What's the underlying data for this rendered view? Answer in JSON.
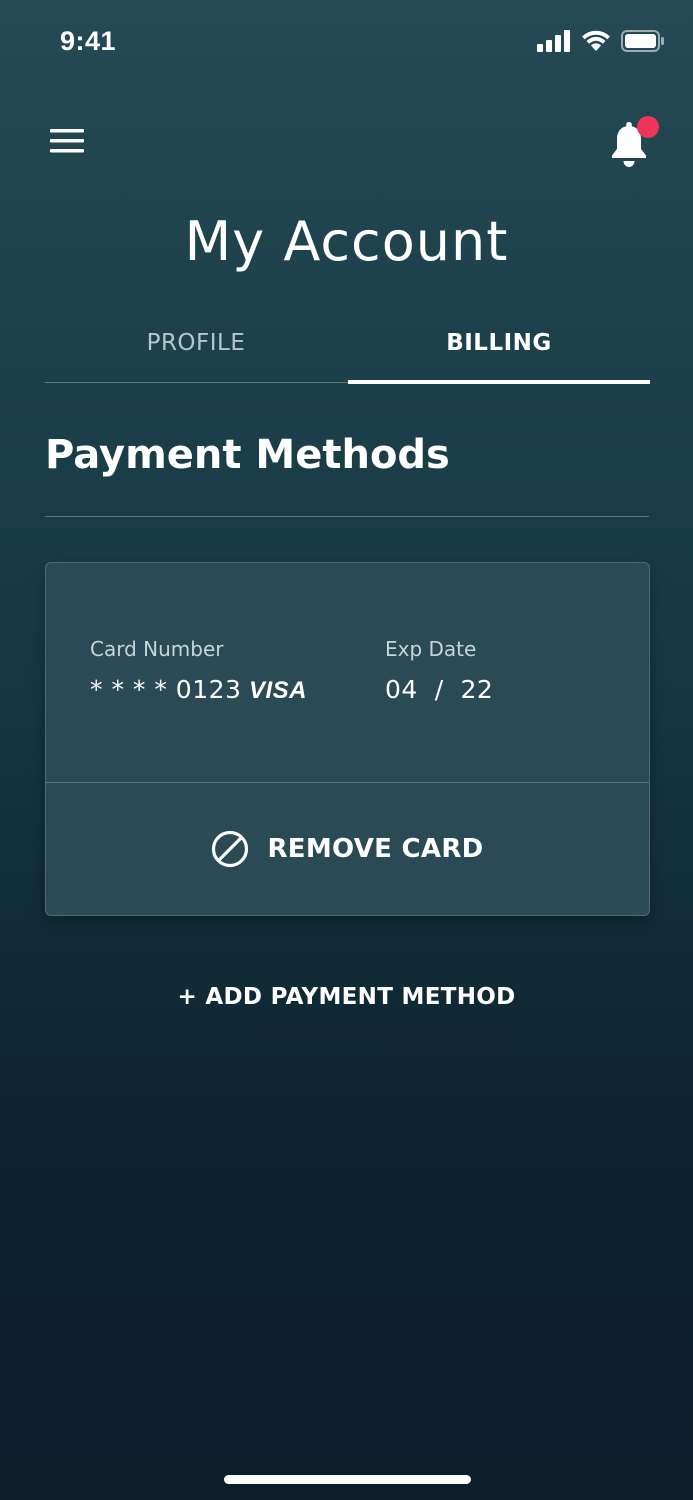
{
  "status_bar": {
    "time": "9:41"
  },
  "header": {
    "title": "My Account"
  },
  "tabs": [
    {
      "label": "PROFILE",
      "active": false
    },
    {
      "label": "BILLING",
      "active": true
    }
  ],
  "section": {
    "title": "Payment Methods"
  },
  "card": {
    "number_label": "Card Number",
    "number_value": "* * * * 0123",
    "brand": "VISA",
    "exp_label": "Exp Date",
    "exp_value": "04  /  22",
    "remove_label": "REMOVE CARD"
  },
  "add_method_label": "+ ADD PAYMENT METHOD",
  "colors": {
    "background_top": "#254a54",
    "background_bottom": "#0a1e2a",
    "card": "#2a4b55",
    "notification_dot": "#f0355a"
  },
  "icons": [
    "signal-icon",
    "wifi-icon",
    "battery-icon",
    "menu-icon",
    "bell-icon",
    "remove-circle-icon"
  ]
}
